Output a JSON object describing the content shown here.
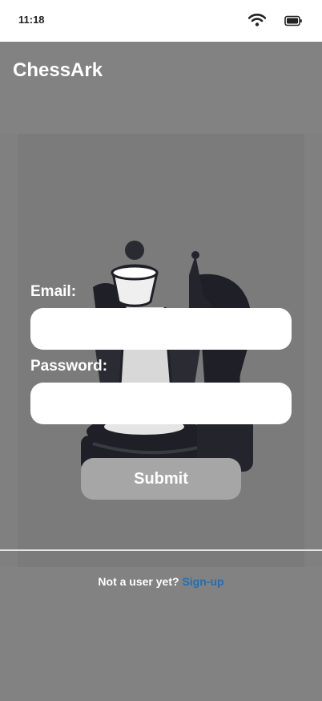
{
  "status_bar": {
    "time": "11:18",
    "icons": [
      "wifi-icon",
      "battery-icon"
    ]
  },
  "header": {
    "title": "ChessArk"
  },
  "form": {
    "email_label": "Email:",
    "email_value": "",
    "password_label": "Password:",
    "password_value": "",
    "submit_label": "Submit"
  },
  "footer": {
    "prompt": "Not a user yet?",
    "signup_link": "Sign-up"
  },
  "colors": {
    "background": "#828282",
    "input_background": "#ffffff",
    "submit_background": "#a6a6a6",
    "link": "#1f6fb3"
  },
  "background_image": "chess-pieces-illustration"
}
